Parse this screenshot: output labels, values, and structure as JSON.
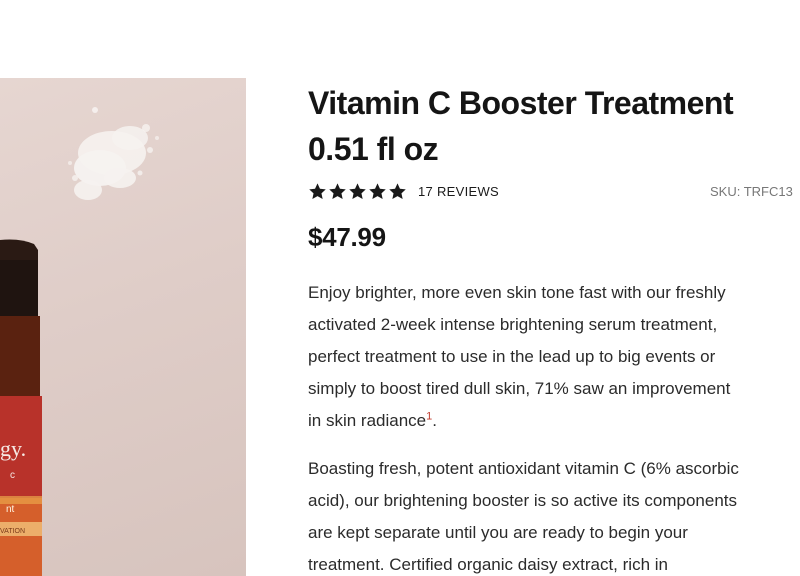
{
  "product": {
    "title_line1": "Vitamin C Booster Treatment",
    "title_line2": "0.51 fl oz",
    "rating_stars": 5,
    "reviews_label": "17 REVIEWS",
    "sku_label": "SKU: TRFC13",
    "price": "$47.99",
    "image": {
      "label_visible_text_1": "gy.",
      "label_visible_text_2": "c",
      "label_visible_text_3": "nt",
      "label_visible_text_4": "VATION"
    }
  },
  "description": {
    "para1": [
      "Enjoy brighter, more even skin tone fast with our freshly",
      "activated 2-week intense brightening serum treatment,",
      "perfect treatment to use in the lead up to big events or",
      "simply to boost tired dull skin, 71% saw an improvement",
      "in skin radiance"
    ],
    "para1_footnote": "1",
    "para1_end": ".",
    "para2": [
      "Boasting fresh, potent antioxidant vitamin C (6% ascorbic",
      "acid), our brightening booster is so active its components",
      "are kept separate until you are ready to begin your",
      "treatment. Certified organic daisy extract, rich in"
    ]
  },
  "colors": {
    "star": "#1a1a1a",
    "image_bg": "#e2d2cd",
    "bottle_red": "#b8322a",
    "bottle_amber": "#6e2a12",
    "footnote": "#c0392b"
  },
  "icons": {
    "rating": "star-icon"
  }
}
